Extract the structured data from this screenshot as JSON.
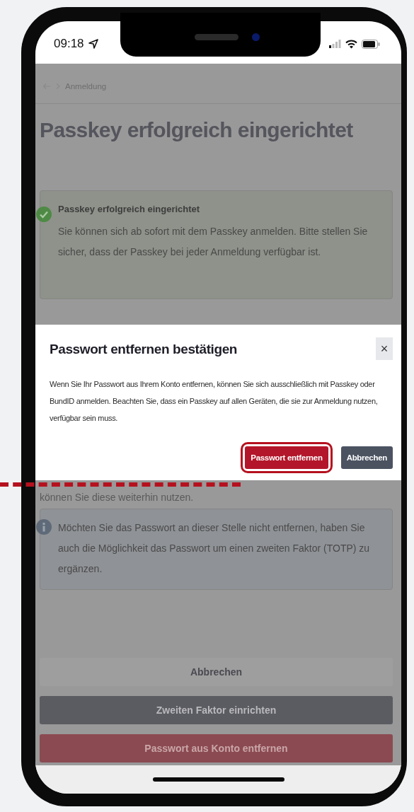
{
  "status_bar": {
    "time": "09:18"
  },
  "breadcrumb": {
    "label": "Anmeldung"
  },
  "heading": "Passkey erfolgreich eingerichtet",
  "success_alert": {
    "title": "Passkey erfolgreich eingerichtet",
    "text": "Sie können sich ab sofort mit dem Passkey anmelden. Bitte stellen Sie sicher, dass der Passkey bei jeder Anmeldung verfügbar ist."
  },
  "dialog": {
    "title": "Passwort entfernen bestätigen",
    "close": "×",
    "text": "Wenn Sie Ihr Passwort aus Ihrem Konto entfernen, können Sie sich ausschließlich mit Passkey oder BundID anmelden. Beachten Sie, dass ein Passkey auf allen Geräten, die sie zur Anmeldung nutzen, verfügbar sein muss.",
    "buttons": [
      {
        "label": "Passwort entfernen",
        "kind": "primary",
        "highlighted": true
      },
      {
        "label": "Abbrechen",
        "kind": "secondary",
        "highlighted": false
      }
    ]
  },
  "partial_text": "können Sie diese weiterhin nutzen.",
  "info_alert": {
    "text": "Möchten Sie das Passwort an dieser Stelle nicht entfernen, haben Sie auch die Möglichkeit das Passwort um einen zweiten Faktor (TOTP) zu ergänzen."
  },
  "actions": [
    {
      "label": "Abbrechen",
      "kind": "plain"
    },
    {
      "label": "Zweiten Faktor einrichten",
      "kind": "secondary"
    },
    {
      "label": "Passwort aus Konto entfernen",
      "kind": "danger"
    }
  ]
}
